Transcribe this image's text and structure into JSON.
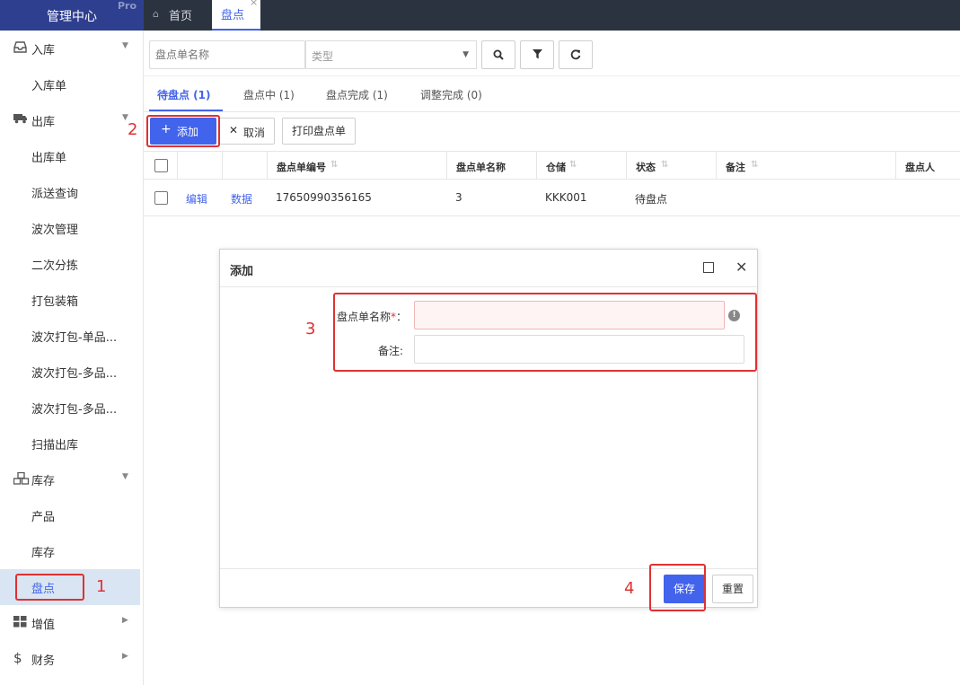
{
  "app": {
    "title": "管理中心",
    "edition": "Pro"
  },
  "tabs": [
    {
      "label": "首页",
      "icon": "home-icon"
    },
    {
      "label": "盘点",
      "close": "×"
    }
  ],
  "sidebar": {
    "groups": [
      {
        "label": "入库",
        "icon": "inbox-icon",
        "items": [
          "入库单"
        ]
      },
      {
        "label": "出库",
        "icon": "truck-icon",
        "items": [
          "出库单",
          "派送查询",
          "波次管理",
          "二次分拣",
          "打包装箱",
          "波次打包-单品...",
          "波次打包-多品...",
          "波次打包-多品...",
          "扫描出库"
        ]
      },
      {
        "label": "库存",
        "icon": "cubes-icon",
        "items": [
          "产品",
          "库存",
          "盘点"
        ]
      },
      {
        "label": "增值",
        "icon": "grid-icon",
        "items": []
      },
      {
        "label": "财务",
        "icon": "dollar-icon",
        "items": []
      }
    ],
    "active_item": "盘点"
  },
  "search": {
    "name_placeholder": "盘点单名称",
    "type_placeholder": "类型"
  },
  "status_tabs": [
    "待盘点 (1)",
    "盘点中 (1)",
    "盘点完成 (1)",
    "调整完成 (0)"
  ],
  "actions": {
    "add": "添加",
    "cancel": "取消",
    "print": "打印盘点单"
  },
  "table": {
    "columns": [
      "盘点单编号",
      "盘点单名称",
      "仓储",
      "状态",
      "备注",
      "盘点人"
    ],
    "rows": [
      {
        "edit": "编辑",
        "data": "数据",
        "code": "17650990356165",
        "name": "3",
        "warehouse": "KKK001",
        "status": "待盘点",
        "remark": "",
        "checker": ""
      }
    ]
  },
  "dialog": {
    "title": "添加",
    "name_label": "盘点单名称",
    "required_mark": "*",
    "colon": "：",
    "remark_label": "备注:",
    "save": "保存",
    "reset": "重置"
  },
  "annotations": [
    "1",
    "2",
    "3",
    "4"
  ],
  "colors": {
    "accent": "#4263eb",
    "annotation": "#e03131",
    "brand_bg": "#2f3f8f",
    "topbar_bg": "#2c3340"
  }
}
